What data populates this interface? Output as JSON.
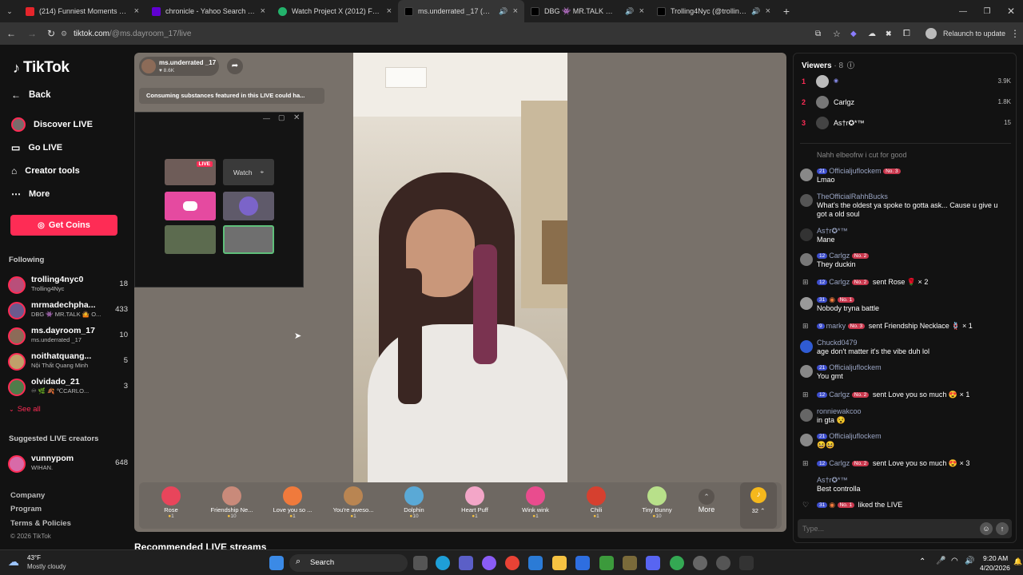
{
  "browser": {
    "tabs": [
      {
        "title": "(214) Funniest Moments On Po",
        "color": "#e5252b"
      },
      {
        "title": "chronicle - Yahoo Search Result",
        "color": "#6001d2"
      },
      {
        "title": "Watch Project X (2012) For Free",
        "color": "#23b36c"
      },
      {
        "title": "ms.underrated _17 (@ms.da",
        "color": "#000000"
      },
      {
        "title": "DBG 👾 MR.TALK 🤷 OF f's D",
        "color": "#000000"
      },
      {
        "title": "Trolling4Nyc (@trolling4ny",
        "color": "#000000"
      }
    ],
    "new_tab": "+",
    "url_host": "tiktok.com",
    "url_path": "/@ms.dayroom_17/live",
    "relaunch": "Relaunch to update"
  },
  "sidebar": {
    "logo": "TikTok",
    "back": "Back",
    "nav": [
      "Discover LIVE",
      "Go LIVE",
      "Creator tools",
      "More"
    ],
    "get_coins": "Get Coins",
    "following_title": "Following",
    "following": [
      {
        "name": "trolling4nyc0",
        "sub": "Trolling4Nyc",
        "count": "18",
        "color": "#b94f7a"
      },
      {
        "name": "mrmadechpha...",
        "sub": "DBG 👾 MR.TALK 🤷 O...",
        "count": "433",
        "color": "#6b5a8e"
      },
      {
        "name": "ms.dayroom_17",
        "sub": "ms.underrated _17",
        "count": "10",
        "color": "#8c6b58"
      },
      {
        "name": "noithatquang...",
        "sub": "Nội Thất Quang Minh",
        "count": "5",
        "color": "#c0a06a"
      },
      {
        "name": "olvidado_21",
        "sub": "♾ 🌿 🍂 ℃CARLO...",
        "count": "3",
        "color": "#4f7c4a"
      }
    ],
    "see_all": "See all",
    "suggested_title": "Suggested LIVE creators",
    "suggested": [
      {
        "name": "vunnypom",
        "sub": "WIHAN.",
        "count": "648",
        "color": "#d86aa8"
      }
    ],
    "footer": [
      "Company",
      "Program",
      "Terms & Policies",
      "© 2026 TikTok"
    ]
  },
  "stream": {
    "host_name": "ms.underrated _17",
    "host_likes": "8.6K",
    "warning": "Consuming substances featured in this LIVE could ha...",
    "popup": {
      "live_badge": "LIVE",
      "watch": "Watch"
    },
    "recommended": "Recommended LIVE streams"
  },
  "gifts": [
    {
      "name": "Rose",
      "price": "1",
      "color": "#e8455b"
    },
    {
      "name": "Friendship Ne...",
      "price": "10",
      "color": "#c98a7a"
    },
    {
      "name": "Love you so ...",
      "price": "1",
      "color": "#f07a3c"
    },
    {
      "name": "You're aweso...",
      "price": "1",
      "color": "#b98552"
    },
    {
      "name": "Dolphin",
      "price": "10",
      "color": "#5aa9d6"
    },
    {
      "name": "Heart Puff",
      "price": "1",
      "color": "#f3a6c8"
    },
    {
      "name": "Wink wink",
      "price": "1",
      "color": "#e94c8e"
    },
    {
      "name": "Chili",
      "price": "1",
      "color": "#d6402f"
    },
    {
      "name": "Tiny Bunny",
      "price": "10",
      "color": "#b8e08a"
    }
  ],
  "gift_more": "More",
  "coins_count": "32",
  "viewers": {
    "title": "Viewers",
    "count": "8",
    "list": [
      {
        "rank": "1",
        "name": "",
        "score": "3.9K"
      },
      {
        "rank": "2",
        "name": "Carlgz",
        "score": "1.8K"
      },
      {
        "rank": "3",
        "name": "As†r✪*™",
        "score": "15"
      }
    ]
  },
  "chat": [
    {
      "user": "",
      "text": "Nahh elbeofrw i cut for good",
      "badges": [],
      "gift": ""
    },
    {
      "user": "Officialjuflockem",
      "text": "Lmao",
      "badges": [
        "21",
        "No. 3"
      ],
      "gift": ""
    },
    {
      "user": "TheOfficialRahhBucks",
      "text": "What's the oldest ya spoke to gotta ask... Cause u give u got a old soul",
      "badges": [],
      "gift": ""
    },
    {
      "user": "As†r✪*™",
      "text": "Mane",
      "badges": [],
      "gift": ""
    },
    {
      "user": "Carlgz",
      "text": "They duckin",
      "badges": [
        "12",
        "No. 2"
      ],
      "gift": ""
    },
    {
      "user": "Carlgz",
      "text": "",
      "badges": [
        "12",
        "No. 2"
      ],
      "gift": "sent Rose 🌹 × 2"
    },
    {
      "user": "",
      "text": "Nobody tryna battle",
      "badges": [
        "31",
        "No. 1"
      ],
      "gift": ""
    },
    {
      "user": "marky",
      "text": "",
      "badges": [
        "9",
        "No. 3"
      ],
      "gift": "sent Friendship Necklace 🪢 × 1"
    },
    {
      "user": "Chuckd0479",
      "text": "age don't matter it's the vibe duh lol",
      "badges": [],
      "gift": ""
    },
    {
      "user": "Officialjuflockem",
      "text": "You gmt",
      "badges": [
        "21"
      ],
      "gift": ""
    },
    {
      "user": "Carlgz",
      "text": "",
      "badges": [
        "12",
        "No. 2"
      ],
      "gift": "sent Love you so much 😍 × 1"
    },
    {
      "user": "ronniewakcoo",
      "text": "in gta 😵",
      "badges": [],
      "gift": ""
    },
    {
      "user": "Officialjuflockem",
      "text": "😆😆",
      "badges": [
        "21"
      ],
      "gift": ""
    },
    {
      "user": "Carlgz",
      "text": "",
      "badges": [
        "12",
        "No. 2"
      ],
      "gift": "sent Love you so much 😍 × 3"
    },
    {
      "user": "As†r✪*™",
      "text": "Best controlla",
      "badges": [],
      "gift": ""
    },
    {
      "user": "",
      "text": "",
      "badges": [
        "31",
        "No. 1"
      ],
      "gift": "liked the LIVE"
    }
  ],
  "chat_placeholder": "Type...",
  "taskbar": {
    "weather_temp": "43°F",
    "weather_desc": "Mostly cloudy",
    "search": "Search",
    "time": "9:20 AM",
    "date": "4/20/2026"
  }
}
